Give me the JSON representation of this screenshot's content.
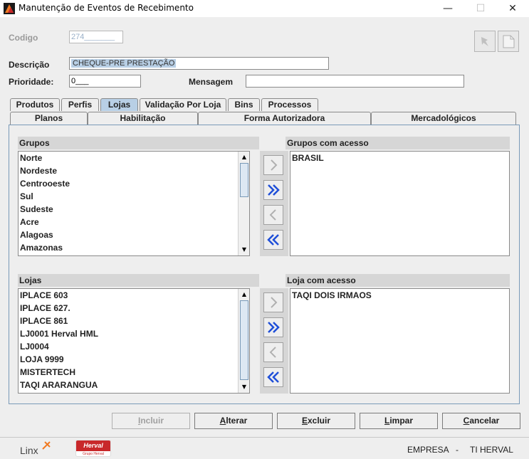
{
  "window": {
    "title": "Manutenção de Eventos de Recebimento"
  },
  "form": {
    "codigo_label": "Codigo",
    "codigo_value": "274_______",
    "descricao_label": "Descrição",
    "descricao_value": "CHEQUE-PRE PRESTAÇÃO",
    "prioridade_label": "Prioridade:",
    "prioridade_value": "0___",
    "mensagem_label": "Mensagem",
    "mensagem_value": ""
  },
  "tabs_row1": [
    "Produtos",
    "Perfis",
    "Lojas",
    "Validação Por Loja",
    "Bins",
    "Processos"
  ],
  "tabs_row2": [
    "Planos",
    "Habilitação",
    "Forma Autorizadora",
    "Mercadológicos"
  ],
  "active_tab": "Lojas",
  "grupos": {
    "header": "Grupos",
    "items": [
      "Norte",
      "Nordeste",
      "Centrooeste",
      "Sul",
      "Sudeste",
      "Acre",
      "Alagoas",
      "Amazonas"
    ]
  },
  "grupos_acesso": {
    "header": "Grupos com acesso",
    "items": [
      "BRASIL"
    ]
  },
  "lojas": {
    "header": "Lojas",
    "items": [
      "IPLACE 603",
      "IPLACE 627.",
      "IPLACE 861",
      "LJ0001 Herval HML",
      "LJ0004",
      "LOJA 9999",
      "MISTERTECH",
      "TAQI ARARANGUA"
    ]
  },
  "lojas_acesso": {
    "header": "Loja com acesso",
    "items": [
      "TAQI DOIS IRMAOS"
    ]
  },
  "buttons": {
    "incluir": {
      "key": "I",
      "rest": "ncluir"
    },
    "alterar": {
      "key": "A",
      "rest": "lterar"
    },
    "excluir": {
      "key": "E",
      "rest": "xcluir"
    },
    "limpar": {
      "key": "L",
      "rest": "impar"
    },
    "cancelar": {
      "key": "C",
      "rest": "ancelar"
    }
  },
  "status": {
    "empresa_label": "EMPRESA",
    "separator": "-",
    "empresa_value": "TI HERVAL",
    "logo1": "Linx",
    "logo2": "Herval",
    "logo2_sub": "Grupo Herval"
  },
  "colors": {
    "accent": "#b8cfe5",
    "arrow_blue": "#1f4fd8",
    "herval_red": "#c8282a",
    "linx_orange": "#f07a22"
  }
}
